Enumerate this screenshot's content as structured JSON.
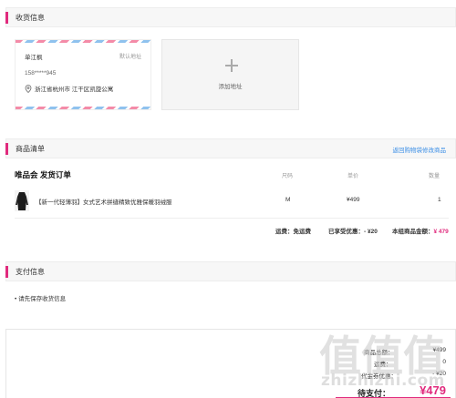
{
  "shipping": {
    "title": "收货信息",
    "address_card": {
      "name": "单江枫",
      "default_tag": "默认地址",
      "phone": "158*****945",
      "address": "浙江省杭州市 江干区凯旋公寓"
    },
    "add_label": "添加地址"
  },
  "products": {
    "title": "商品清单",
    "back_link": "返回购物袋修改商品",
    "store": "唯品会 发货订单",
    "columns": {
      "size": "尺码",
      "price": "单价",
      "qty": "数量"
    },
    "items": [
      {
        "title": "【新一代轻薄羽】女式艺术拼缝精致优雅保暖羽绒服",
        "size": "M",
        "price": "¥499",
        "qty": "1"
      }
    ],
    "totals": {
      "shipping_label": "运费：",
      "shipping_value": "免运费",
      "discount_label": "已享受优惠：",
      "discount_value": "- ¥20",
      "group_total_label": "本组商品金额：",
      "group_total_value": "¥ 479"
    }
  },
  "payment": {
    "title": "支付信息",
    "note": "• 请先保存收货信息"
  },
  "summary": {
    "rows": [
      {
        "label": "商品总额：",
        "value": "¥499"
      },
      {
        "label": "运费：",
        "value": "0"
      },
      {
        "label": "代金券优惠：",
        "value": "- ¥20"
      }
    ],
    "due_label": "待支付：",
    "due_value": "¥479"
  },
  "watermark": {
    "glyphs": [
      "值",
      "值",
      "值"
    ],
    "text": "zhizhizhi.com"
  },
  "colors": {
    "accent": "#e02a7d",
    "link": "#3a8ee6"
  },
  "icons": {
    "location": "location-pin-icon",
    "add": "plus-icon",
    "product": "product-thumbnail"
  }
}
